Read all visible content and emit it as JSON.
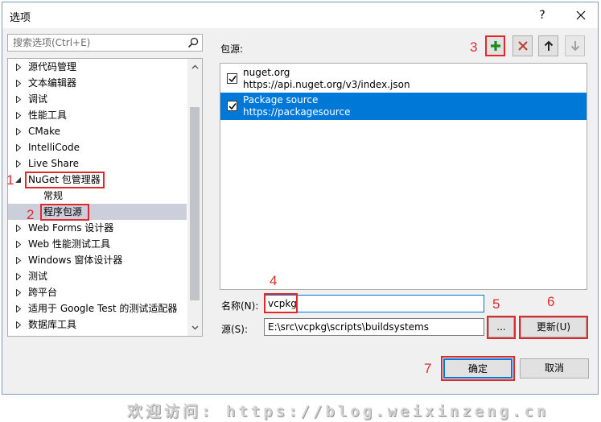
{
  "window": {
    "title": "选项",
    "help": "?"
  },
  "search": {
    "placeholder": "搜索选项(Ctrl+E)"
  },
  "tree": [
    {
      "label": "源代码管理",
      "expanded": false
    },
    {
      "label": "文本编辑器",
      "expanded": false
    },
    {
      "label": "调试",
      "expanded": false
    },
    {
      "label": "性能工具",
      "expanded": false
    },
    {
      "label": "CMake",
      "expanded": false
    },
    {
      "label": "IntelliCode",
      "expanded": false
    },
    {
      "label": "Live Share",
      "expanded": false
    },
    {
      "label": "NuGet 包管理器",
      "expanded": true
    },
    {
      "label": "常规",
      "child": true
    },
    {
      "label": "程序包源",
      "child": true,
      "selected": true
    },
    {
      "label": "Web Forms 设计器",
      "expanded": false
    },
    {
      "label": "Web 性能测试工具",
      "expanded": false
    },
    {
      "label": "Windows 窗体设计器",
      "expanded": false
    },
    {
      "label": "测试",
      "expanded": false
    },
    {
      "label": "跨平台",
      "expanded": false
    },
    {
      "label": "适用于 Google Test 的测试适配器",
      "expanded": false
    },
    {
      "label": "数据库工具",
      "expanded": false
    }
  ],
  "sources_label": "包源:",
  "sources": [
    {
      "name": "nuget.org",
      "url": "https://api.nuget.org/v3/index.json",
      "checked": true,
      "selected": false
    },
    {
      "name": "Package source",
      "url": "https://packagesource",
      "checked": true,
      "selected": true
    }
  ],
  "form": {
    "name_label": "名称(N):",
    "name_value": "vcpkg",
    "source_label": "源(S):",
    "source_value": "E:\\src\\vcpkg\\scripts\\buildsystems",
    "browse_label": "...",
    "update_label": "更新(U)"
  },
  "buttons": {
    "ok": "确定",
    "cancel": "取消"
  },
  "annotations": [
    "1",
    "2",
    "3",
    "4",
    "5",
    "6",
    "7"
  ],
  "watermark": "欢迎访问: https://blog.weixinzeng.cn",
  "colors": {
    "accent": "#0078d7",
    "annotation": "#e0292b",
    "add": "#1e8a1e",
    "remove": "#c0392b"
  }
}
